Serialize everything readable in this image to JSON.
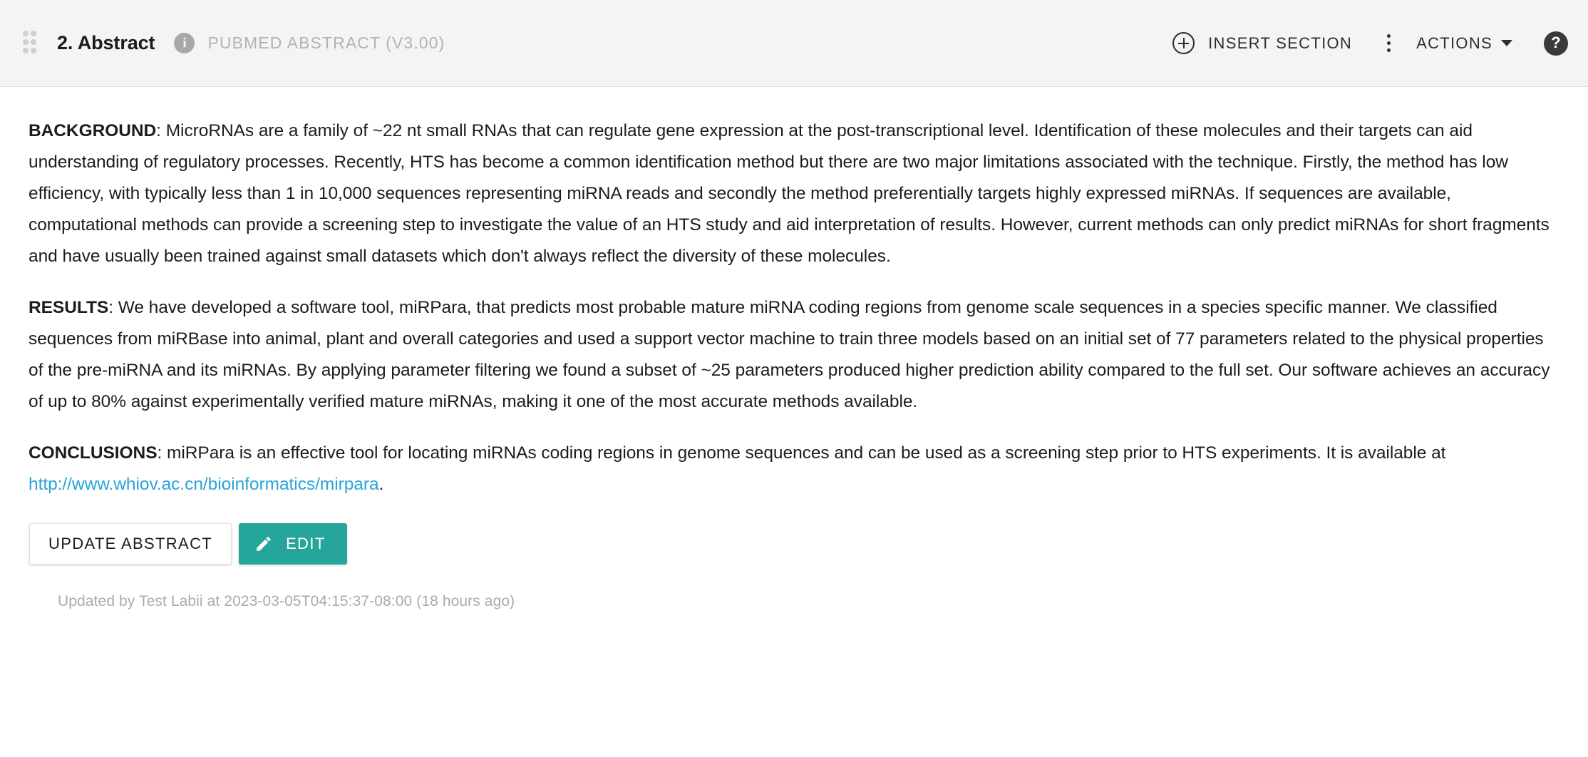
{
  "header": {
    "drag_handle_icon": "drag-handle-icon",
    "title": "2. Abstract",
    "info_icon": "info-icon",
    "info_glyph": "i",
    "subtitle": "PUBMED ABSTRACT (V3.00)",
    "insert_section_label": "INSERT SECTION",
    "plus_icon": "plus-circle-icon",
    "kebab_icon": "more-vertical-icon",
    "actions_label": "ACTIONS",
    "caret_icon": "chevron-down-icon",
    "help_icon": "help-circle-icon",
    "help_glyph": "?",
    "background_color": "#f4f4f4",
    "border_color": "#e0e0e0"
  },
  "abstract": {
    "background": {
      "label": "BACKGROUND",
      "separator": ": ",
      "text": "MicroRNAs are a family of ~22 nt small RNAs that can regulate gene expression at the post-transcriptional level. Identification of these molecules and their targets can aid understanding of regulatory processes. Recently, HTS has become a common identification method but there are two major limitations associated with the technique. Firstly, the method has low efficiency, with typically less than 1 in 10,000 sequences representing miRNA reads and secondly the method preferentially targets highly expressed miRNAs. If sequences are available, computational methods can provide a screening step to investigate the value of an HTS study and aid interpretation of results. However, current methods can only predict miRNAs for short fragments and have usually been trained against small datasets which don't always reflect the diversity of these molecules."
    },
    "results": {
      "label": "RESULTS",
      "separator": ": ",
      "text": "We have developed a software tool, miRPara, that predicts most probable mature miRNA coding regions from genome scale sequences in a species specific manner. We classified sequences from miRBase into animal, plant and overall categories and used a support vector machine to train three models based on an initial set of 77 parameters related to the physical properties of the pre-miRNA and its miRNAs. By applying parameter filtering we found a subset of ~25 parameters produced higher prediction ability compared to the full set. Our software achieves an accuracy of up to 80% against experimentally verified mature miRNAs, making it one of the most accurate methods available."
    },
    "conclusions": {
      "label": "CONCLUSIONS",
      "separator": ": ",
      "text_before_link": "miRPara is an effective tool for locating miRNAs coding regions in genome sequences and can be used as a screening step prior to HTS experiments. It is available at ",
      "link_text": "http://www.whiov.ac.cn/bioinformatics/mirpara",
      "link_color": "#28a4d9",
      "text_after_link": "."
    }
  },
  "buttons": {
    "update_abstract_label": "UPDATE ABSTRACT",
    "edit_label": "EDIT",
    "edit_icon": "pencil-icon",
    "edit_color": "#26a69a"
  },
  "footer": {
    "updated_note": "Updated by Test Labii at 2023-03-05T04:15:37-08:00 (18 hours ago)"
  }
}
